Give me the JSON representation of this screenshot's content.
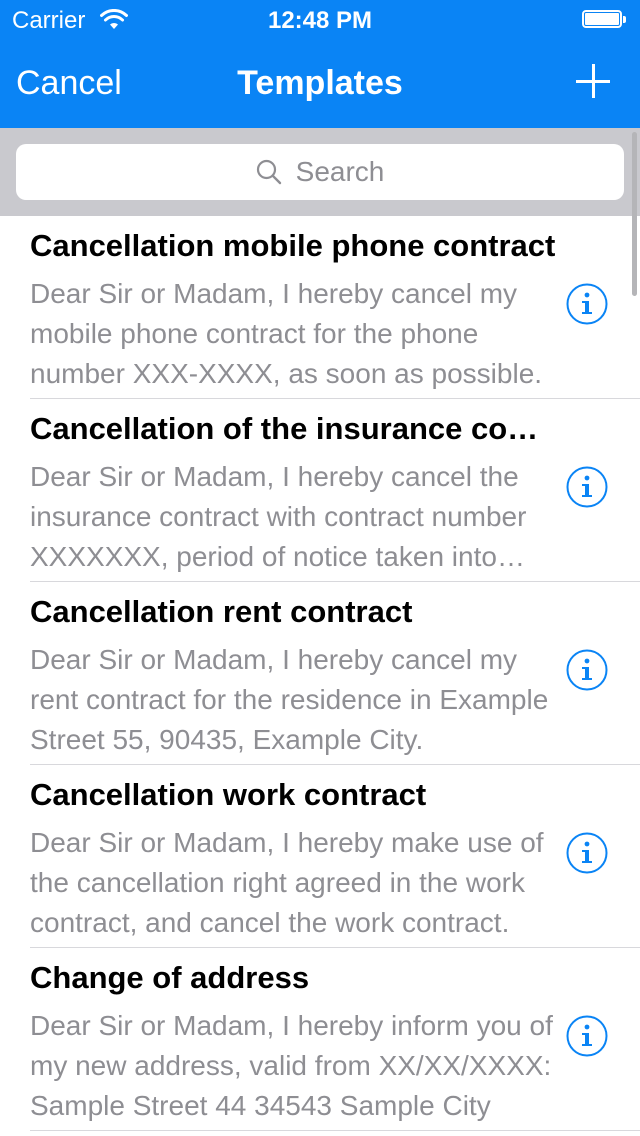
{
  "status": {
    "carrier": "Carrier",
    "time": "12:48 PM"
  },
  "nav": {
    "cancel": "Cancel",
    "title": "Templates",
    "add_icon": "plus-icon"
  },
  "search": {
    "placeholder": "Search"
  },
  "colors": {
    "accent": "#0a84f5",
    "search_bg": "#c9c9ce",
    "secondary_text": "#8e8e93"
  },
  "templates": [
    {
      "title": "Cancellation mobile phone contract",
      "description": "Dear Sir or Madam,  I hereby cancel my mobile phone contract for the phone number XXX-XXXX, as soon as possible."
    },
    {
      "title": "Cancellation of the insurance contract",
      "description": "Dear Sir or Madam,  I hereby cancel the insurance contract with contract number XXXXXXX, period of notice taken into account."
    },
    {
      "title": "Cancellation rent contract",
      "description": "Dear Sir or Madam,  I hereby cancel my rent contract for the residence in Example Street 55, 90435, Example City."
    },
    {
      "title": "Cancellation work contract",
      "description": "Dear Sir or Madam,  I hereby make use of the cancellation right agreed in the work contract, and cancel the work contract."
    },
    {
      "title": "Change of address",
      "description": "Dear Sir or Madam,  I hereby inform you of my new address, valid from XX/XX/XXXX:  Sample Street 44 34543 Sample City"
    }
  ]
}
